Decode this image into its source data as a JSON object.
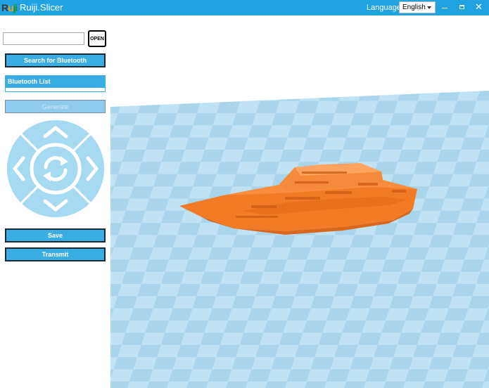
{
  "window": {
    "title": "Ruiji.Slicer",
    "language_label": "Language",
    "language_value": "English",
    "close_glyph": "✕"
  },
  "left_panel": {
    "file_path_value": "",
    "open_label": "OPEN",
    "search_bluetooth_label": "Search for Bluetooth",
    "bluetooth_list_label": "Bluetooth List",
    "generate_label": "Generate",
    "save_label": "Save",
    "transmit_label": "Transmit"
  },
  "dpad": {
    "up_icon": "chevron-up-icon",
    "down_icon": "chevron-down-icon",
    "left_icon": "chevron-left-icon",
    "right_icon": "chevron-right-icon",
    "center_icon": "refresh-icon"
  },
  "viewport": {
    "model": "boat-model",
    "model_color": "#f47b25",
    "floor_color_light": "#bfe3f2",
    "floor_color_dark": "#a8d5ea"
  },
  "colors": {
    "accent": "#1fa3e1",
    "button": "#3aaee2"
  }
}
